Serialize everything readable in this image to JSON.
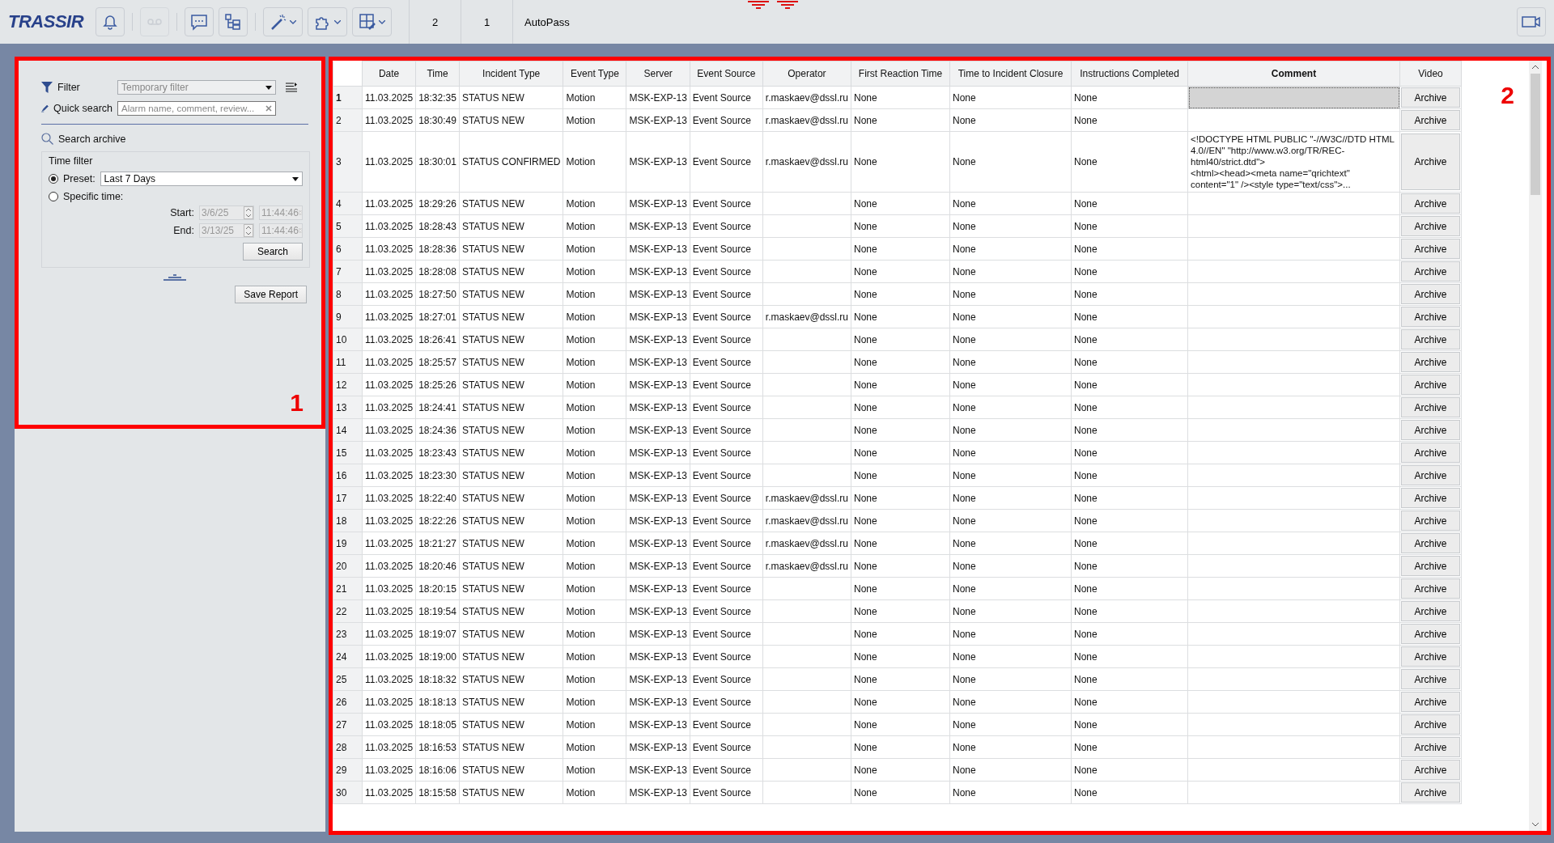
{
  "toolbar": {
    "logo": "TRASSIR",
    "buttons": [
      {
        "kind": "bell",
        "disabled": false,
        "menu": false
      },
      {
        "kind": "voicemail",
        "disabled": true,
        "menu": false
      },
      {
        "kind": "chat",
        "disabled": false,
        "menu": false
      },
      {
        "kind": "tree",
        "disabled": false,
        "menu": false
      },
      {
        "kind": "wand",
        "disabled": false,
        "menu": true
      },
      {
        "kind": "puzzle",
        "disabled": false,
        "menu": true
      },
      {
        "kind": "gridtool",
        "disabled": false,
        "menu": true
      }
    ],
    "tabs": [
      {
        "label": "2"
      },
      {
        "label": "1"
      },
      {
        "label": "AutoPass"
      }
    ]
  },
  "left_panel": {
    "annotation": "1",
    "filter": {
      "label": "Filter",
      "value": "Temporary filter"
    },
    "quick_search": {
      "label": "Quick search",
      "placeholder": "Alarm name, comment, review..."
    },
    "search_archive": "Search archive",
    "time_filter": {
      "title": "Time filter",
      "options": [
        {
          "label": "Preset:",
          "selected": true
        },
        {
          "label": "Specific time:",
          "selected": false
        }
      ],
      "preset": "Last 7 Days",
      "ranges": [
        {
          "label": "Start:",
          "date": "3/6/25",
          "time": "11:44:46",
          "disabled": true
        },
        {
          "label": "End:",
          "date": "3/13/25",
          "time": "11:44:46",
          "disabled": true
        }
      ],
      "search_button": "Search"
    },
    "save_button": "Save Report"
  },
  "table": {
    "annotation": "2",
    "columns": [
      "Date",
      "Time",
      "Incident Type",
      "Event Type",
      "Server",
      "Event Source",
      "Operator",
      "First Reaction Time",
      "Time to Incident Closure",
      "Instructions Completed",
      "Comment",
      "Video"
    ],
    "rows": [
      {
        "number": "1",
        "selected": true,
        "date": "11.03.2025",
        "time": "18:32:35",
        "incident_type": "STATUS NEW",
        "event_type": "Motion",
        "server": "MSK-EXP-13",
        "event_source": "Event Source",
        "operator": "r.maskaev@dssl.ru",
        "first_reaction": "None",
        "closure": "None",
        "instructions": "None",
        "video": "Archive"
      },
      {
        "number": "2",
        "selected": false,
        "date": "11.03.2025",
        "time": "18:30:49",
        "incident_type": "STATUS NEW",
        "event_type": "Motion",
        "server": "MSK-EXP-13",
        "event_source": "Event Source",
        "operator": "r.maskaev@dssl.ru",
        "first_reaction": "None",
        "closure": "None",
        "instructions": "None",
        "video": "Archive"
      },
      {
        "number": "3",
        "selected": false,
        "date": "11.03.2025",
        "time": "18:30:01",
        "incident_type": "STATUS CONFIRMED",
        "event_type": "Motion",
        "server": "MSK-EXP-13",
        "event_source": "Event Source",
        "operator": "r.maskaev@dssl.ru",
        "first_reaction": "None",
        "closure": "None",
        "instructions": "None",
        "comment": "<!DOCTYPE HTML PUBLIC \"-//W3C//DTD HTML 4.0//EN\" \"http://www.w3.org/TR/REC-html40/strict.dtd\">\n<html><head><meta name=\"qrichtext\" content=\"1\" /><style type=\"text/css\">...",
        "video": "Archive"
      },
      {
        "number": "4",
        "selected": false,
        "date": "11.03.2025",
        "time": "18:29:26",
        "incident_type": "STATUS NEW",
        "event_type": "Motion",
        "server": "MSK-EXP-13",
        "event_source": "Event Source",
        "first_reaction": "None",
        "closure": "None",
        "instructions": "None",
        "video": "Archive"
      },
      {
        "number": "5",
        "selected": false,
        "date": "11.03.2025",
        "time": "18:28:43",
        "incident_type": "STATUS NEW",
        "event_type": "Motion",
        "server": "MSK-EXP-13",
        "event_source": "Event Source",
        "first_reaction": "None",
        "closure": "None",
        "instructions": "None",
        "video": "Archive"
      },
      {
        "number": "6",
        "selected": false,
        "date": "11.03.2025",
        "time": "18:28:36",
        "incident_type": "STATUS NEW",
        "event_type": "Motion",
        "server": "MSK-EXP-13",
        "event_source": "Event Source",
        "first_reaction": "None",
        "closure": "None",
        "instructions": "None",
        "video": "Archive"
      },
      {
        "number": "7",
        "selected": false,
        "date": "11.03.2025",
        "time": "18:28:08",
        "incident_type": "STATUS NEW",
        "event_type": "Motion",
        "server": "MSK-EXP-13",
        "event_source": "Event Source",
        "first_reaction": "None",
        "closure": "None",
        "instructions": "None",
        "video": "Archive"
      },
      {
        "number": "8",
        "selected": false,
        "date": "11.03.2025",
        "time": "18:27:50",
        "incident_type": "STATUS NEW",
        "event_type": "Motion",
        "server": "MSK-EXP-13",
        "event_source": "Event Source",
        "first_reaction": "None",
        "closure": "None",
        "instructions": "None",
        "video": "Archive"
      },
      {
        "number": "9",
        "selected": false,
        "date": "11.03.2025",
        "time": "18:27:01",
        "incident_type": "STATUS NEW",
        "event_type": "Motion",
        "server": "MSK-EXP-13",
        "event_source": "Event Source",
        "operator": "r.maskaev@dssl.ru",
        "first_reaction": "None",
        "closure": "None",
        "instructions": "None",
        "video": "Archive"
      },
      {
        "number": "10",
        "selected": false,
        "date": "11.03.2025",
        "time": "18:26:41",
        "incident_type": "STATUS NEW",
        "event_type": "Motion",
        "server": "MSK-EXP-13",
        "event_source": "Event Source",
        "first_reaction": "None",
        "closure": "None",
        "instructions": "None",
        "video": "Archive"
      },
      {
        "number": "11",
        "selected": false,
        "date": "11.03.2025",
        "time": "18:25:57",
        "incident_type": "STATUS NEW",
        "event_type": "Motion",
        "server": "MSK-EXP-13",
        "event_source": "Event Source",
        "first_reaction": "None",
        "closure": "None",
        "instructions": "None",
        "video": "Archive"
      },
      {
        "number": "12",
        "selected": false,
        "date": "11.03.2025",
        "time": "18:25:26",
        "incident_type": "STATUS NEW",
        "event_type": "Motion",
        "server": "MSK-EXP-13",
        "event_source": "Event Source",
        "first_reaction": "None",
        "closure": "None",
        "instructions": "None",
        "video": "Archive"
      },
      {
        "number": "13",
        "selected": false,
        "date": "11.03.2025",
        "time": "18:24:41",
        "incident_type": "STATUS NEW",
        "event_type": "Motion",
        "server": "MSK-EXP-13",
        "event_source": "Event Source",
        "first_reaction": "None",
        "closure": "None",
        "instructions": "None",
        "video": "Archive"
      },
      {
        "number": "14",
        "selected": false,
        "date": "11.03.2025",
        "time": "18:24:36",
        "incident_type": "STATUS NEW",
        "event_type": "Motion",
        "server": "MSK-EXP-13",
        "event_source": "Event Source",
        "first_reaction": "None",
        "closure": "None",
        "instructions": "None",
        "video": "Archive"
      },
      {
        "number": "15",
        "selected": false,
        "date": "11.03.2025",
        "time": "18:23:43",
        "incident_type": "STATUS NEW",
        "event_type": "Motion",
        "server": "MSK-EXP-13",
        "event_source": "Event Source",
        "first_reaction": "None",
        "closure": "None",
        "instructions": "None",
        "video": "Archive"
      },
      {
        "number": "16",
        "selected": false,
        "date": "11.03.2025",
        "time": "18:23:30",
        "incident_type": "STATUS NEW",
        "event_type": "Motion",
        "server": "MSK-EXP-13",
        "event_source": "Event Source",
        "first_reaction": "None",
        "closure": "None",
        "instructions": "None",
        "video": "Archive"
      },
      {
        "number": "17",
        "selected": false,
        "date": "11.03.2025",
        "time": "18:22:40",
        "incident_type": "STATUS NEW",
        "event_type": "Motion",
        "server": "MSK-EXP-13",
        "event_source": "Event Source",
        "operator": "r.maskaev@dssl.ru",
        "first_reaction": "None",
        "closure": "None",
        "instructions": "None",
        "video": "Archive"
      },
      {
        "number": "18",
        "selected": false,
        "date": "11.03.2025",
        "time": "18:22:26",
        "incident_type": "STATUS NEW",
        "event_type": "Motion",
        "server": "MSK-EXP-13",
        "event_source": "Event Source",
        "operator": "r.maskaev@dssl.ru",
        "first_reaction": "None",
        "closure": "None",
        "instructions": "None",
        "video": "Archive"
      },
      {
        "number": "19",
        "selected": false,
        "date": "11.03.2025",
        "time": "18:21:27",
        "incident_type": "STATUS NEW",
        "event_type": "Motion",
        "server": "MSK-EXP-13",
        "event_source": "Event Source",
        "operator": "r.maskaev@dssl.ru",
        "first_reaction": "None",
        "closure": "None",
        "instructions": "None",
        "video": "Archive"
      },
      {
        "number": "20",
        "selected": false,
        "date": "11.03.2025",
        "time": "18:20:46",
        "incident_type": "STATUS NEW",
        "event_type": "Motion",
        "server": "MSK-EXP-13",
        "event_source": "Event Source",
        "operator": "r.maskaev@dssl.ru",
        "first_reaction": "None",
        "closure": "None",
        "instructions": "None",
        "video": "Archive"
      },
      {
        "number": "21",
        "selected": false,
        "date": "11.03.2025",
        "time": "18:20:15",
        "incident_type": "STATUS NEW",
        "event_type": "Motion",
        "server": "MSK-EXP-13",
        "event_source": "Event Source",
        "first_reaction": "None",
        "closure": "None",
        "instructions": "None",
        "video": "Archive"
      },
      {
        "number": "22",
        "selected": false,
        "date": "11.03.2025",
        "time": "18:19:54",
        "incident_type": "STATUS NEW",
        "event_type": "Motion",
        "server": "MSK-EXP-13",
        "event_source": "Event Source",
        "first_reaction": "None",
        "closure": "None",
        "instructions": "None",
        "video": "Archive"
      },
      {
        "number": "23",
        "selected": false,
        "date": "11.03.2025",
        "time": "18:19:07",
        "incident_type": "STATUS NEW",
        "event_type": "Motion",
        "server": "MSK-EXP-13",
        "event_source": "Event Source",
        "first_reaction": "None",
        "closure": "None",
        "instructions": "None",
        "video": "Archive"
      },
      {
        "number": "24",
        "selected": false,
        "date": "11.03.2025",
        "time": "18:19:00",
        "incident_type": "STATUS NEW",
        "event_type": "Motion",
        "server": "MSK-EXP-13",
        "event_source": "Event Source",
        "first_reaction": "None",
        "closure": "None",
        "instructions": "None",
        "video": "Archive"
      },
      {
        "number": "25",
        "selected": false,
        "date": "11.03.2025",
        "time": "18:18:32",
        "incident_type": "STATUS NEW",
        "event_type": "Motion",
        "server": "MSK-EXP-13",
        "event_source": "Event Source",
        "first_reaction": "None",
        "closure": "None",
        "instructions": "None",
        "video": "Archive"
      },
      {
        "number": "26",
        "selected": false,
        "date": "11.03.2025",
        "time": "18:18:13",
        "incident_type": "STATUS NEW",
        "event_type": "Motion",
        "server": "MSK-EXP-13",
        "event_source": "Event Source",
        "first_reaction": "None",
        "closure": "None",
        "instructions": "None",
        "video": "Archive"
      },
      {
        "number": "27",
        "selected": false,
        "date": "11.03.2025",
        "time": "18:18:05",
        "incident_type": "STATUS NEW",
        "event_type": "Motion",
        "server": "MSK-EXP-13",
        "event_source": "Event Source",
        "first_reaction": "None",
        "closure": "None",
        "instructions": "None",
        "video": "Archive"
      },
      {
        "number": "28",
        "selected": false,
        "date": "11.03.2025",
        "time": "18:16:53",
        "incident_type": "STATUS NEW",
        "event_type": "Motion",
        "server": "MSK-EXP-13",
        "event_source": "Event Source",
        "first_reaction": "None",
        "closure": "None",
        "instructions": "None",
        "video": "Archive"
      },
      {
        "number": "29",
        "selected": false,
        "date": "11.03.2025",
        "time": "18:16:06",
        "incident_type": "STATUS NEW",
        "event_type": "Motion",
        "server": "MSK-EXP-13",
        "event_source": "Event Source",
        "first_reaction": "None",
        "closure": "None",
        "instructions": "None",
        "video": "Archive"
      },
      {
        "number": "30",
        "selected": false,
        "date": "11.03.2025",
        "time": "18:15:58",
        "incident_type": "STATUS NEW",
        "event_type": "Motion",
        "server": "MSK-EXP-13",
        "event_source": "Event Source",
        "first_reaction": "None",
        "closure": "None",
        "instructions": "None",
        "video": "Archive"
      }
    ]
  }
}
